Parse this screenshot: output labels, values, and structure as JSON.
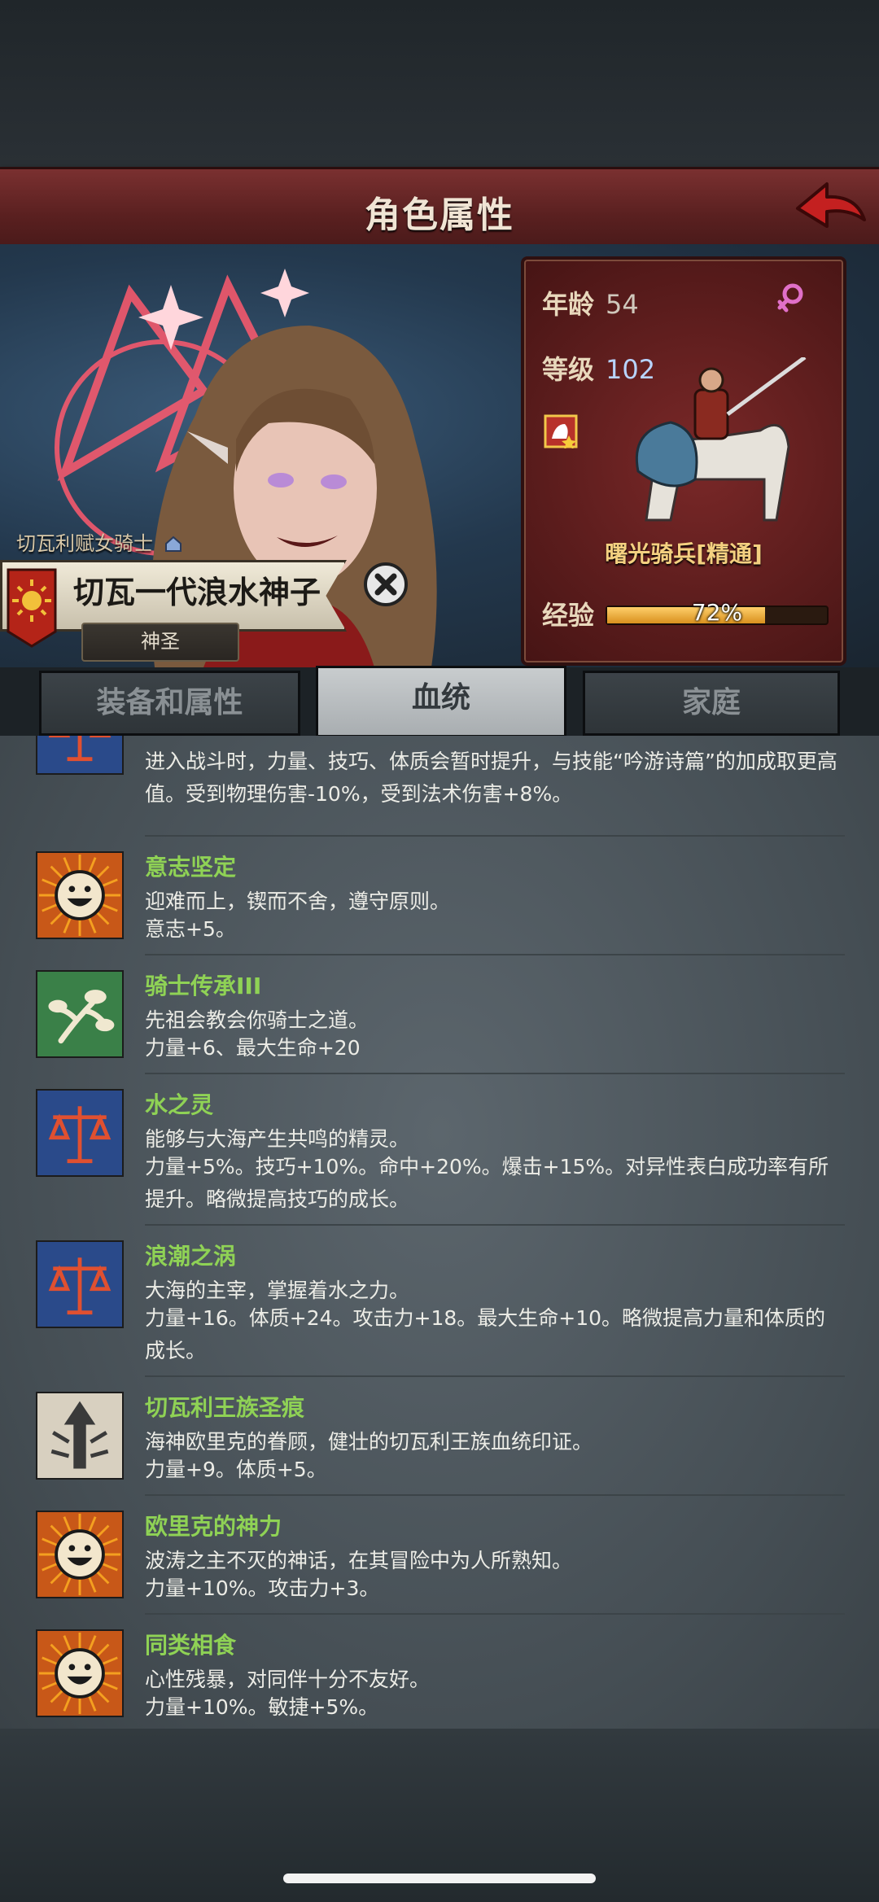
{
  "header": {
    "title": "角色属性"
  },
  "character": {
    "title_tag": "切瓦利赋女骑士",
    "name": "切瓦一代浪水神子",
    "rank": "神圣"
  },
  "stats": {
    "age_label": "年龄",
    "age_value": "54",
    "level_label": "等级",
    "level_value": "102",
    "class_name": "曙光骑兵[精通]",
    "exp_label": "经验",
    "exp_text": "72%",
    "exp_fraction": 0.72
  },
  "tabs": [
    {
      "label": "装备和属性"
    },
    {
      "label": "血统"
    },
    {
      "label": "家庭"
    }
  ],
  "traits": {
    "partial": {
      "icon": "scales-icon",
      "effect": "进入战斗时，力量、技巧、体质会暂时提升，与技能“吟游诗篇”的加成取更高值。受到物理伤害-10%，受到法术伤害+8%。"
    },
    "items": [
      {
        "icon": "smiley-icon",
        "name": "意志坚定",
        "desc": "迎难而上，锲而不舍，遵守原则。",
        "effect": "意志+5。"
      },
      {
        "icon": "branch-icon",
        "name": "骑士传承III",
        "desc": "先祖会教会你骑士之道。",
        "effect": "力量+6、最大生命+20"
      },
      {
        "icon": "scales-icon",
        "name": "水之灵",
        "desc": "能够与大海产生共鸣的精灵。",
        "effect": "力量+5%。技巧+10%。命中+20%。爆击+15%。对异性表白成功率有所提升。略微提高技巧的成长。"
      },
      {
        "icon": "scales-icon",
        "name": "浪潮之涡",
        "desc": "大海的主宰，掌握着水之力。",
        "effect": "力量+16。体质+24。攻击力+18。最大生命+10。略微提高力量和体质的成长。"
      },
      {
        "icon": "scar-icon",
        "name": "切瓦利王族圣痕",
        "desc": "海神欧里克的眷顾，健壮的切瓦利王族血统印证。",
        "effect": "力量+9。体质+5。"
      },
      {
        "icon": "smiley-icon",
        "name": "欧里克的神力",
        "desc": "波涛之主不灭的神话，在其冒险中为人所熟知。",
        "effect": "力量+10%。攻击力+3。"
      },
      {
        "icon": "smiley-icon",
        "name": "同类相食",
        "desc": "心性残暴，对同伴十分不友好。",
        "effect": "力量+10%。敏捷+5%。"
      }
    ]
  },
  "colors": {
    "trait_name": "#8fd255",
    "title_bar": "#6a2626",
    "stats_panel": "#5a1c1c",
    "level_value": "#b8d4ff",
    "class_name": "#f4d080"
  }
}
